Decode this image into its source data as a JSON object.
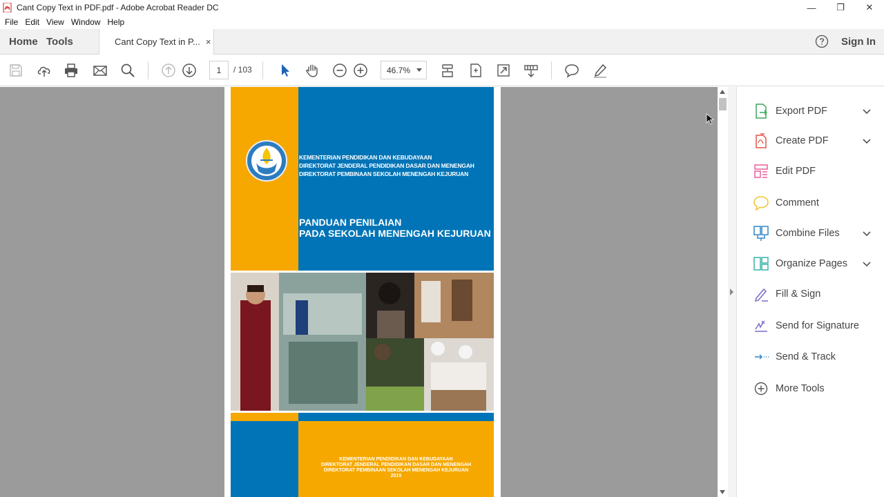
{
  "window": {
    "title": "Cant Copy Text in PDF.pdf - Adobe Acrobat Reader DC",
    "minimize": "—",
    "restore": "❐",
    "close": "✕"
  },
  "menu": [
    "File",
    "Edit",
    "View",
    "Window",
    "Help"
  ],
  "tabs": {
    "home": "Home",
    "tools": "Tools",
    "document": "Cant Copy Text in P...",
    "close": "×",
    "sign_in": "Sign In"
  },
  "toolbar": {
    "current_page": "1",
    "page_total": "/  103",
    "zoom": "46.7%"
  },
  "document": {
    "org_lines": [
      "KEMENTERIAN PENDIDIKAN DAN KEBUDAYAAN",
      "DIREKTORAT JENDERAL PENDIDIKAN DASAR DAN MENENGAH",
      "DIREKTORAT PEMBINAAN SEKOLAH MENENGAH KEJURUAN"
    ],
    "title_lines": [
      "PANDUAN PENILAIAN",
      "PADA SEKOLAH MENENGAH KEJURUAN"
    ],
    "back_lines": [
      "KEMENTERIAN PENDIDIKAN DAN KEBUDAYAAN",
      "DIREKTORAT JENDERAL PENDIDIKAN DASAR DAN MENENGAH",
      "DIREKTORAT PEMBINAAN SEKOLAH MENENGAH KEJURUAN",
      "2015"
    ]
  },
  "tools_pane": [
    {
      "label": "Export PDF",
      "icon": "export-pdf-icon",
      "color": "#3aa65a",
      "expandable": true
    },
    {
      "label": "Create PDF",
      "icon": "create-pdf-icon",
      "color": "#e0554a",
      "expandable": true
    },
    {
      "label": "Edit PDF",
      "icon": "edit-pdf-icon",
      "color": "#e85d9c",
      "expandable": false
    },
    {
      "label": "Comment",
      "icon": "comment-icon",
      "color": "#f3c53a",
      "expandable": false
    },
    {
      "label": "Combine Files",
      "icon": "combine-files-icon",
      "color": "#2f86c9",
      "expandable": true
    },
    {
      "label": "Organize Pages",
      "icon": "organize-pages-icon",
      "color": "#3ab3a6",
      "expandable": true
    },
    {
      "label": "Fill & Sign",
      "icon": "fill-sign-icon",
      "color": "#7b68c8",
      "expandable": false
    },
    {
      "label": "Send for Signature",
      "icon": "send-signature-icon",
      "color": "#7b68c8",
      "expandable": false
    },
    {
      "label": "Send & Track",
      "icon": "send-track-icon",
      "color": "#2f86c9",
      "expandable": false
    },
    {
      "label": "More Tools",
      "icon": "more-tools-icon",
      "color": "#555555",
      "expandable": false
    }
  ]
}
